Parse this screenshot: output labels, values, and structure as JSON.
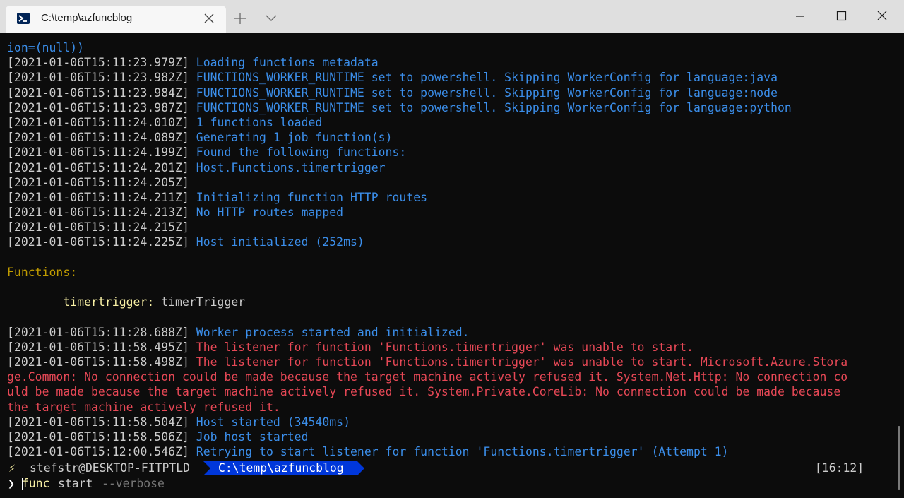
{
  "window": {
    "tab_title": "C:\\temp\\azfuncblog",
    "icons": {
      "tab": "powershell-icon",
      "close_tab": "close-icon",
      "new_tab": "plus-icon",
      "dropdown": "chevron-down-icon",
      "minimize": "minimize-icon",
      "maximize": "maximize-icon",
      "close_window": "close-icon"
    }
  },
  "colors": {
    "background": "#0c0c0c",
    "info": "#3b8eea",
    "error": "#e74856",
    "timestamp": "#cccccc",
    "heading": "#c19c00",
    "path_segment": "#0037da"
  },
  "log": [
    {
      "ts": "",
      "msg": "ion=(null))",
      "kind": "info"
    },
    {
      "ts": "[2021-01-06T15:11:23.979Z]",
      "msg": " Loading functions metadata",
      "kind": "info"
    },
    {
      "ts": "[2021-01-06T15:11:23.982Z]",
      "msg": " FUNCTIONS_WORKER_RUNTIME set to powershell. Skipping WorkerConfig for language:java",
      "kind": "info"
    },
    {
      "ts": "[2021-01-06T15:11:23.984Z]",
      "msg": " FUNCTIONS_WORKER_RUNTIME set to powershell. Skipping WorkerConfig for language:node",
      "kind": "info"
    },
    {
      "ts": "[2021-01-06T15:11:23.987Z]",
      "msg": " FUNCTIONS_WORKER_RUNTIME set to powershell. Skipping WorkerConfig for language:python",
      "kind": "info"
    },
    {
      "ts": "[2021-01-06T15:11:24.010Z]",
      "msg": " 1 functions loaded",
      "kind": "info"
    },
    {
      "ts": "[2021-01-06T15:11:24.089Z]",
      "msg": " Generating 1 job function(s)",
      "kind": "info"
    },
    {
      "ts": "[2021-01-06T15:11:24.199Z]",
      "msg": " Found the following functions:",
      "kind": "info"
    },
    {
      "ts": "[2021-01-06T15:11:24.201Z]",
      "msg": " Host.Functions.timertrigger",
      "kind": "info"
    },
    {
      "ts": "[2021-01-06T15:11:24.205Z]",
      "msg": "",
      "kind": "info"
    },
    {
      "ts": "[2021-01-06T15:11:24.211Z]",
      "msg": " Initializing function HTTP routes",
      "kind": "info"
    },
    {
      "ts": "[2021-01-06T15:11:24.213Z]",
      "msg": " No HTTP routes mapped",
      "kind": "info"
    },
    {
      "ts": "[2021-01-06T15:11:24.215Z]",
      "msg": "",
      "kind": "info"
    },
    {
      "ts": "[2021-01-06T15:11:24.225Z]",
      "msg": " Host initialized (252ms)",
      "kind": "info"
    },
    {
      "ts": "",
      "msg": "",
      "kind": "blank"
    },
    {
      "ts": "",
      "msg": "Functions:",
      "kind": "heading"
    },
    {
      "ts": "",
      "msg": "",
      "kind": "blank"
    },
    {
      "ts": "",
      "msg": "",
      "kind": "function",
      "fn_name": "        timertrigger:",
      "fn_type": " timerTrigger"
    },
    {
      "ts": "",
      "msg": "",
      "kind": "blank"
    },
    {
      "ts": "[2021-01-06T15:11:28.688Z]",
      "msg": " Worker process started and initialized.",
      "kind": "info"
    },
    {
      "ts": "[2021-01-06T15:11:58.495Z]",
      "msg": " The listener for function 'Functions.timertrigger' was unable to start.",
      "kind": "error"
    },
    {
      "ts": "[2021-01-06T15:11:58.498Z]",
      "msg": " The listener for function 'Functions.timertrigger' was unable to start. Microsoft.Azure.Stora",
      "kind": "error"
    },
    {
      "ts": "",
      "msg": "ge.Common: No connection could be made because the target machine actively refused it. System.Net.Http: No connection co",
      "kind": "error"
    },
    {
      "ts": "",
      "msg": "uld be made because the target machine actively refused it. System.Private.CoreLib: No connection could be made because",
      "kind": "error"
    },
    {
      "ts": "",
      "msg": "the target machine actively refused it.",
      "kind": "error"
    },
    {
      "ts": "[2021-01-06T15:11:58.504Z]",
      "msg": " Host started (34540ms)",
      "kind": "info"
    },
    {
      "ts": "[2021-01-06T15:11:58.506Z]",
      "msg": " Job host started",
      "kind": "info"
    },
    {
      "ts": "[2021-01-06T15:12:00.546Z]",
      "msg": " Retrying to start listener for function 'Functions.timertrigger' (Attempt 1)",
      "kind": "info"
    }
  ],
  "prompt": {
    "bolt": "⚡",
    "user_host": "stefstr@DESKTOP-FITPTLD",
    "path": "C:\\temp\\azfuncblog",
    "time": "[16:12]",
    "chevron": "❯",
    "command": "func",
    "arg": "start",
    "flag": "--verbose"
  }
}
